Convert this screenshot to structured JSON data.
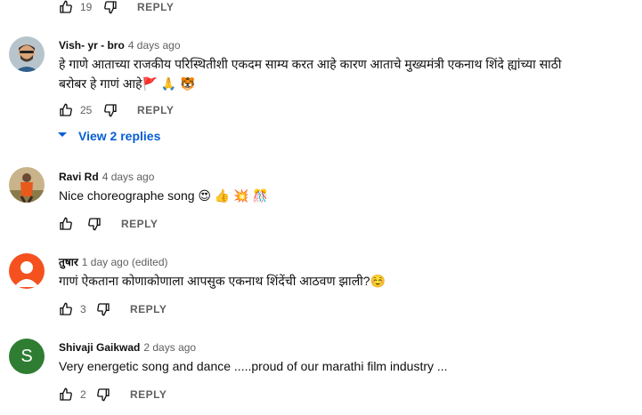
{
  "comments": [
    {
      "likes": "19",
      "reply": "REPLY"
    },
    {
      "author": "Vish- yr - bro",
      "time": "4 days ago",
      "text_line1": "हे गाणे आताच्या राजकीय परिस्थितीशी एकदम साम्य करत आहे कारण आताचे मुख्यमंत्री एकनाथ शिंदे ह्यांच्या साठी",
      "text_line2": "बरोबर हे गाणं आहे🚩 🙏 🐯",
      "likes": "25",
      "reply": "REPLY",
      "view_replies": "View 2 replies"
    },
    {
      "author": "Ravi Rd",
      "time": "4 days ago",
      "text": "Nice choreographe  song 😍 👍 💥 🎊",
      "likes": "",
      "reply": "REPLY"
    },
    {
      "author": "तुषार",
      "time": "1 day ago (edited)",
      "text": "गाणं ऐकताना कोणाकोणाला आपसुक एकनाथ शिंदेंची आठवण झाली?☺️",
      "likes": "3",
      "reply": "REPLY"
    },
    {
      "author": "Shivaji Gaikwad",
      "time": "2 days ago",
      "avatar_letter": "S",
      "text": "Very energetic song and dance .....proud of our marathi film industry ...",
      "likes": "2",
      "reply": "REPLY"
    }
  ],
  "colors": {
    "link_blue": "#065fd4",
    "meta_gray": "#606060",
    "avatar_s_green": "#2e7d32",
    "avatar_t_orange": "#f4511e"
  },
  "icons": [
    "thumbs-up-icon",
    "thumbs-down-icon",
    "caret-down-icon"
  ]
}
